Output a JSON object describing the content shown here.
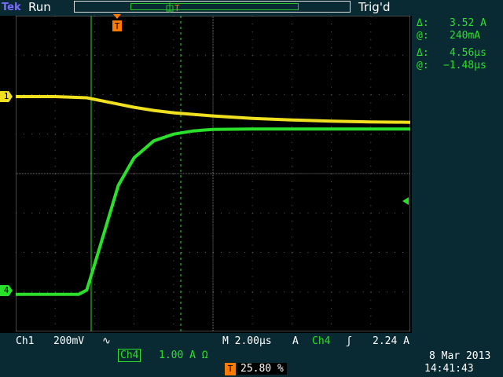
{
  "header": {
    "brand": "Tek",
    "run_state": "Run",
    "trigger_status": "Trig'd"
  },
  "cursor_readouts": {
    "amp_delta": "3.52 A",
    "amp_at": "240mA",
    "time_delta": "4.56µs",
    "time_at": "−1.48µs",
    "delta_symbol": "Δ:",
    "at_symbol": "@:"
  },
  "channels": {
    "ch1_marker": "1",
    "ch4_marker": "4",
    "ch1_label": "Ch1",
    "ch1_scale": "200mV",
    "ch1_coupling": "∿",
    "ch4_label": "Ch4",
    "ch4_scale": "1.00 A Ω"
  },
  "timebase": {
    "horizontal": "M 2.00µs",
    "trigger_source_label": "A",
    "trigger_channel": "Ch4",
    "trigger_slope": "ʃ",
    "trigger_level": "2.24 A",
    "trigger_position": "25.80 %",
    "trigger_marker": "T"
  },
  "datetime": {
    "date": "8 Mar  2013",
    "time": "14:41:43"
  },
  "colors": {
    "ch1": "#f0e020",
    "ch4": "#2ae02a",
    "trigger": "#ff7a00",
    "panel": "#0a2a33"
  },
  "waveforms": {
    "ch1_time_div": [
      0.0,
      1.0,
      1.8,
      2.0,
      2.5,
      3.0,
      3.5,
      4.0,
      5.0,
      6.0,
      7.0,
      8.0,
      9.0,
      10.0
    ],
    "ch1_div": [
      1.95,
      1.95,
      1.92,
      1.88,
      1.78,
      1.68,
      1.6,
      1.54,
      1.46,
      1.4,
      1.36,
      1.33,
      1.31,
      1.3
    ],
    "ch4_time_div": [
      0.0,
      1.6,
      1.8,
      2.0,
      2.3,
      2.6,
      3.0,
      3.5,
      4.0,
      4.5,
      5.0,
      6.0,
      8.0,
      10.0
    ],
    "ch4_div": [
      -3.06,
      -3.06,
      -2.95,
      -2.3,
      -1.3,
      -0.3,
      0.4,
      0.83,
      1.0,
      1.08,
      1.12,
      1.13,
      1.13,
      1.13
    ]
  }
}
